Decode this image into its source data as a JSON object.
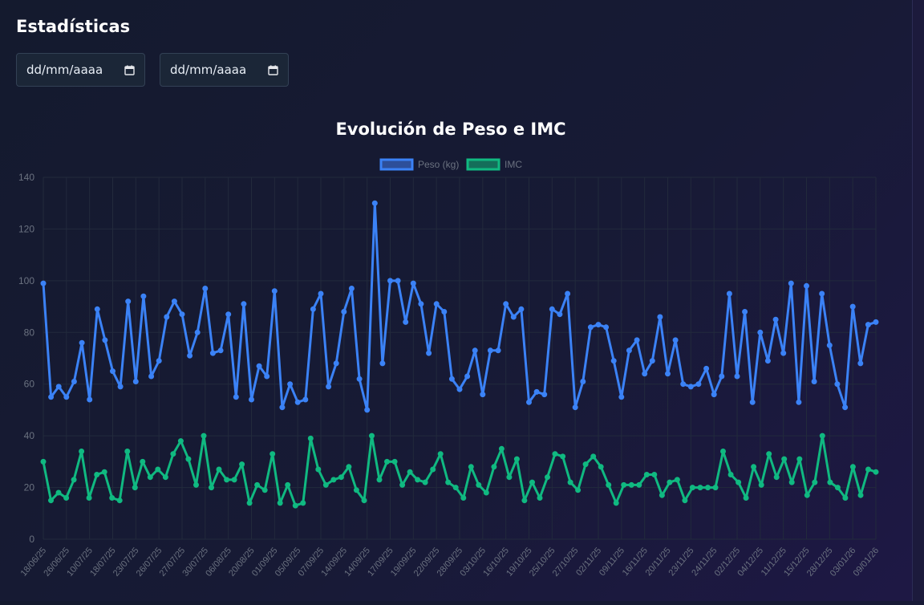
{
  "page": {
    "title": "Estadísticas"
  },
  "filters": {
    "start_date": {
      "placeholder": "dd/mm/aaaa"
    },
    "end_date": {
      "placeholder": "dd/mm/aaaa"
    }
  },
  "colors": {
    "peso": "#3b82f6",
    "imc": "#10b981",
    "tick": "#6b7280",
    "grid": "#222a3c"
  },
  "chart_data": {
    "type": "line",
    "title": "Evolución de Peso e IMC",
    "ylim": [
      0,
      140
    ],
    "yticks": [
      0,
      20,
      40,
      60,
      80,
      100,
      120,
      140
    ],
    "grid": true,
    "legend_position": "top-center",
    "x_tick_labels": [
      "18/06/25",
      "26/06/25",
      "10/07/25",
      "18/07/25",
      "23/07/25",
      "26/07/25",
      "27/07/25",
      "30/07/25",
      "06/08/25",
      "20/08/25",
      "01/09/25",
      "05/09/25",
      "07/09/25",
      "14/09/25",
      "14/09/25",
      "17/09/25",
      "19/09/25",
      "22/09/25",
      "28/09/25",
      "03/10/25",
      "16/10/25",
      "19/10/25",
      "25/10/25",
      "27/10/25",
      "02/11/25",
      "09/11/25",
      "16/11/25",
      "20/11/25",
      "23/11/25",
      "24/11/25",
      "02/12/25",
      "04/12/25",
      "11/12/25",
      "15/12/25",
      "28/12/25",
      "03/01/26",
      "09/01/26"
    ],
    "series": [
      {
        "name": "Peso (kg)",
        "values": [
          99,
          55,
          59,
          55,
          61,
          76,
          54,
          89,
          77,
          65,
          59,
          92,
          61,
          94,
          63,
          69,
          86,
          92,
          87,
          71,
          80,
          97,
          72,
          73,
          87,
          55,
          91,
          54,
          67,
          63,
          96,
          51,
          60,
          53,
          54,
          89,
          95,
          59,
          68,
          88,
          97,
          62,
          50,
          130,
          68,
          100,
          100,
          84,
          99,
          91,
          72,
          91,
          88,
          62,
          58,
          63,
          73,
          56,
          73,
          73,
          91,
          86,
          89,
          53,
          57,
          56,
          89,
          87,
          95,
          51,
          61,
          82,
          83,
          82,
          69,
          55,
          73,
          77,
          64,
          69,
          86,
          64,
          77,
          60,
          59,
          60,
          66,
          56,
          63,
          95,
          63,
          88,
          53,
          80,
          69,
          85,
          72,
          99,
          53,
          98,
          61,
          95,
          75,
          60,
          51,
          90,
          68,
          83,
          84
        ]
      },
      {
        "name": "IMC",
        "values": [
          30,
          15,
          18,
          16,
          23,
          34,
          16,
          25,
          26,
          16,
          15,
          34,
          20,
          30,
          24,
          27,
          24,
          33,
          38,
          31,
          21,
          40,
          20,
          27,
          23,
          23,
          29,
          14,
          21,
          19,
          33,
          14,
          21,
          13,
          14,
          39,
          27,
          21,
          23,
          24,
          28,
          19,
          15,
          40,
          23,
          30,
          30,
          21,
          26,
          23,
          22,
          27,
          33,
          22,
          20,
          16,
          28,
          21,
          18,
          28,
          35,
          24,
          31,
          15,
          22,
          16,
          24,
          33,
          32,
          22,
          19,
          29,
          32,
          28,
          21,
          14,
          21,
          21,
          21,
          25,
          25,
          17,
          22,
          23,
          15,
          20,
          20,
          20,
          20,
          34,
          25,
          22,
          16,
          28,
          21,
          33,
          24,
          31,
          22,
          31,
          17,
          22,
          40,
          22,
          20,
          16,
          28,
          17,
          27,
          26
        ]
      }
    ]
  }
}
